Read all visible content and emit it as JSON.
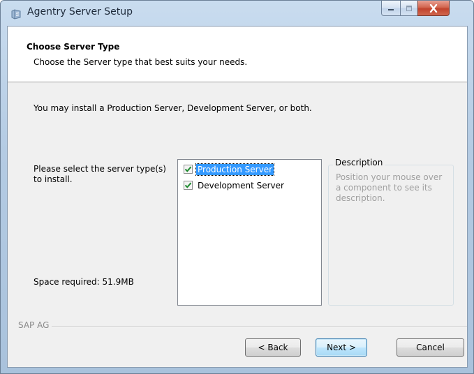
{
  "window": {
    "title": "Agentry Server Setup",
    "icon": "setup-icon",
    "controls": {
      "minimize": "minimize-icon",
      "maximize": "maximize-icon",
      "close": "close-icon"
    }
  },
  "header": {
    "title": "Choose Server Type",
    "subtitle": "Choose the Server type that best suits your needs."
  },
  "body": {
    "intro": "You may install a Production Server, Development Server, or both.",
    "select_label": "Please select the server type(s) to install.",
    "space_required": "Space required: 51.9MB",
    "components": [
      {
        "label": "Production Server",
        "checked": true,
        "selected": true
      },
      {
        "label": "Development Server",
        "checked": true,
        "selected": false
      }
    ],
    "description": {
      "legend": "Description",
      "text": "Position your mouse over a component to see its description."
    }
  },
  "footer": {
    "brand": "SAP AG",
    "back_label": "< Back",
    "next_label": "Next >",
    "cancel_label": "Cancel"
  },
  "colors": {
    "selection": "#3399ff",
    "check": "#1e8a2e",
    "close_button": "#c7432b"
  }
}
